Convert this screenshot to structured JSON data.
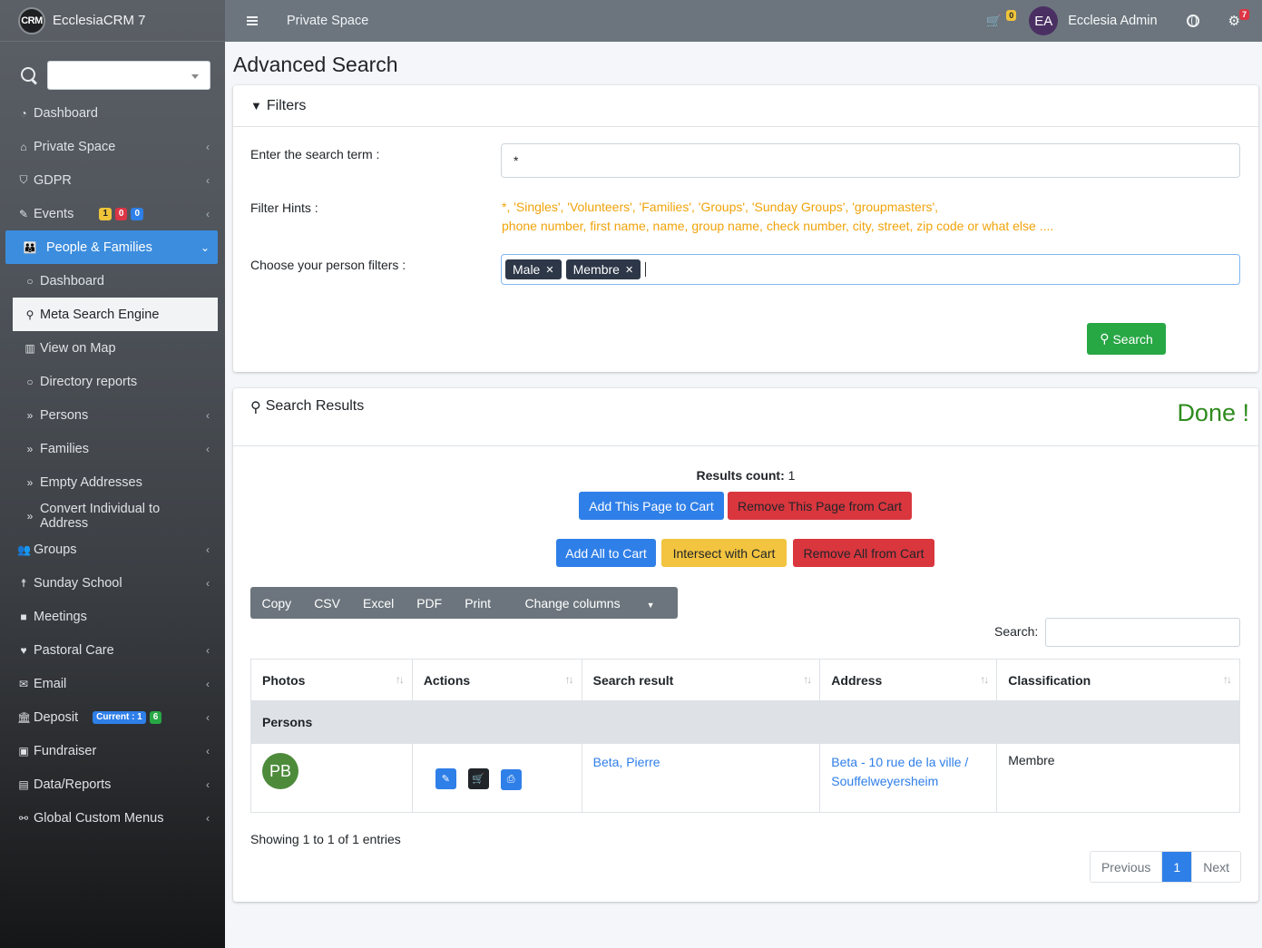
{
  "app": {
    "brand_logo": "CRM",
    "brand_name": "EcclesiaCRM 7"
  },
  "topbar": {
    "title": "Private Space",
    "cart_count": "0",
    "avatar": "EA",
    "user": "Ecclesia Admin",
    "notif_count": "7"
  },
  "sidebar": {
    "items": [
      {
        "label": "Dashboard",
        "icon": "dashboard-icon"
      },
      {
        "label": "Private Space",
        "icon": "home-icon"
      },
      {
        "label": "GDPR",
        "icon": "shield-icon"
      },
      {
        "label": "Events",
        "icon": "ticket-icon",
        "badges": [
          "1",
          "0",
          "0"
        ]
      },
      {
        "label": "People & Families",
        "icon": "people-icon"
      },
      {
        "label": "Dashboard",
        "icon": "circle-icon"
      },
      {
        "label": "Meta Search Engine",
        "icon": "search-icon"
      },
      {
        "label": "View on Map",
        "icon": "map-icon"
      },
      {
        "label": "Directory reports",
        "icon": "circle-icon"
      },
      {
        "label": "Persons",
        "icon": "angle-double-right-icon"
      },
      {
        "label": "Families",
        "icon": "angle-double-right-icon"
      },
      {
        "label": "Empty Addresses",
        "icon": "angle-double-right-icon"
      },
      {
        "label": "Convert Individual to Address",
        "icon": "angle-double-right-icon"
      },
      {
        "label": "Groups",
        "icon": "users-icon"
      },
      {
        "label": "Sunday School",
        "icon": "child-icon"
      },
      {
        "label": "Meetings",
        "icon": "video-icon"
      },
      {
        "label": "Pastoral Care",
        "icon": "heart-icon"
      },
      {
        "label": "Email",
        "icon": "envelope-icon"
      },
      {
        "label": "Deposit",
        "icon": "bank-icon",
        "badges": [
          "Current : 1",
          "6"
        ]
      },
      {
        "label": "Fundraiser",
        "icon": "money-icon"
      },
      {
        "label": "Data/Reports",
        "icon": "file-pdf-icon"
      },
      {
        "label": "Global Custom Menus",
        "icon": "link-icon"
      }
    ]
  },
  "page": {
    "title": "Advanced Search"
  },
  "filters": {
    "header": "Filters",
    "search_label": "Enter the search term :",
    "search_value": "*",
    "hints_label": "Filter Hints :",
    "hints_line1": "*, 'Singles', 'Volunteers', 'Families', 'Groups', 'Sunday Groups', 'groupmasters',",
    "hints_line2": "phone number, first name, name, group name, check number, city, street, zip code or what else ....",
    "person_filters_label": "Choose your person filters :",
    "tags": [
      "Male",
      "Membre"
    ],
    "search_button": "Search"
  },
  "results": {
    "header": "Search Results",
    "status": "Done !",
    "count_label": "Results count:",
    "count_value": "1",
    "add_page": "Add This Page to Cart",
    "remove_page": "Remove This Page from Cart",
    "add_all": "Add All to Cart",
    "intersect": "Intersect with Cart",
    "remove_all": "Remove All from Cart",
    "export_buttons": [
      "Copy",
      "CSV",
      "Excel",
      "PDF",
      "Print",
      "Change columns"
    ],
    "table_search_label": "Search:",
    "columns": [
      "Photos",
      "Actions",
      "Search result",
      "Address",
      "Classification"
    ],
    "group_label": "Persons",
    "rows": [
      {
        "initials": "PB",
        "name": "Beta, Pierre",
        "address_line1": "Beta - 10 rue de la ville /",
        "address_line2": "Souffelweyersheim",
        "classification": "Membre"
      }
    ],
    "info": "Showing 1 to 1 of 1 entries",
    "pager": {
      "prev": "Previous",
      "page": "1",
      "next": "Next"
    }
  },
  "colors": {
    "primary": "#2f7fe8",
    "success": "#28a745",
    "danger": "#d9363e",
    "warning": "#f3c43f",
    "sidebar_active": "#3c8dde",
    "avatar_pb": "#4d8b3b",
    "avatar_ea": "#4a2f63"
  }
}
